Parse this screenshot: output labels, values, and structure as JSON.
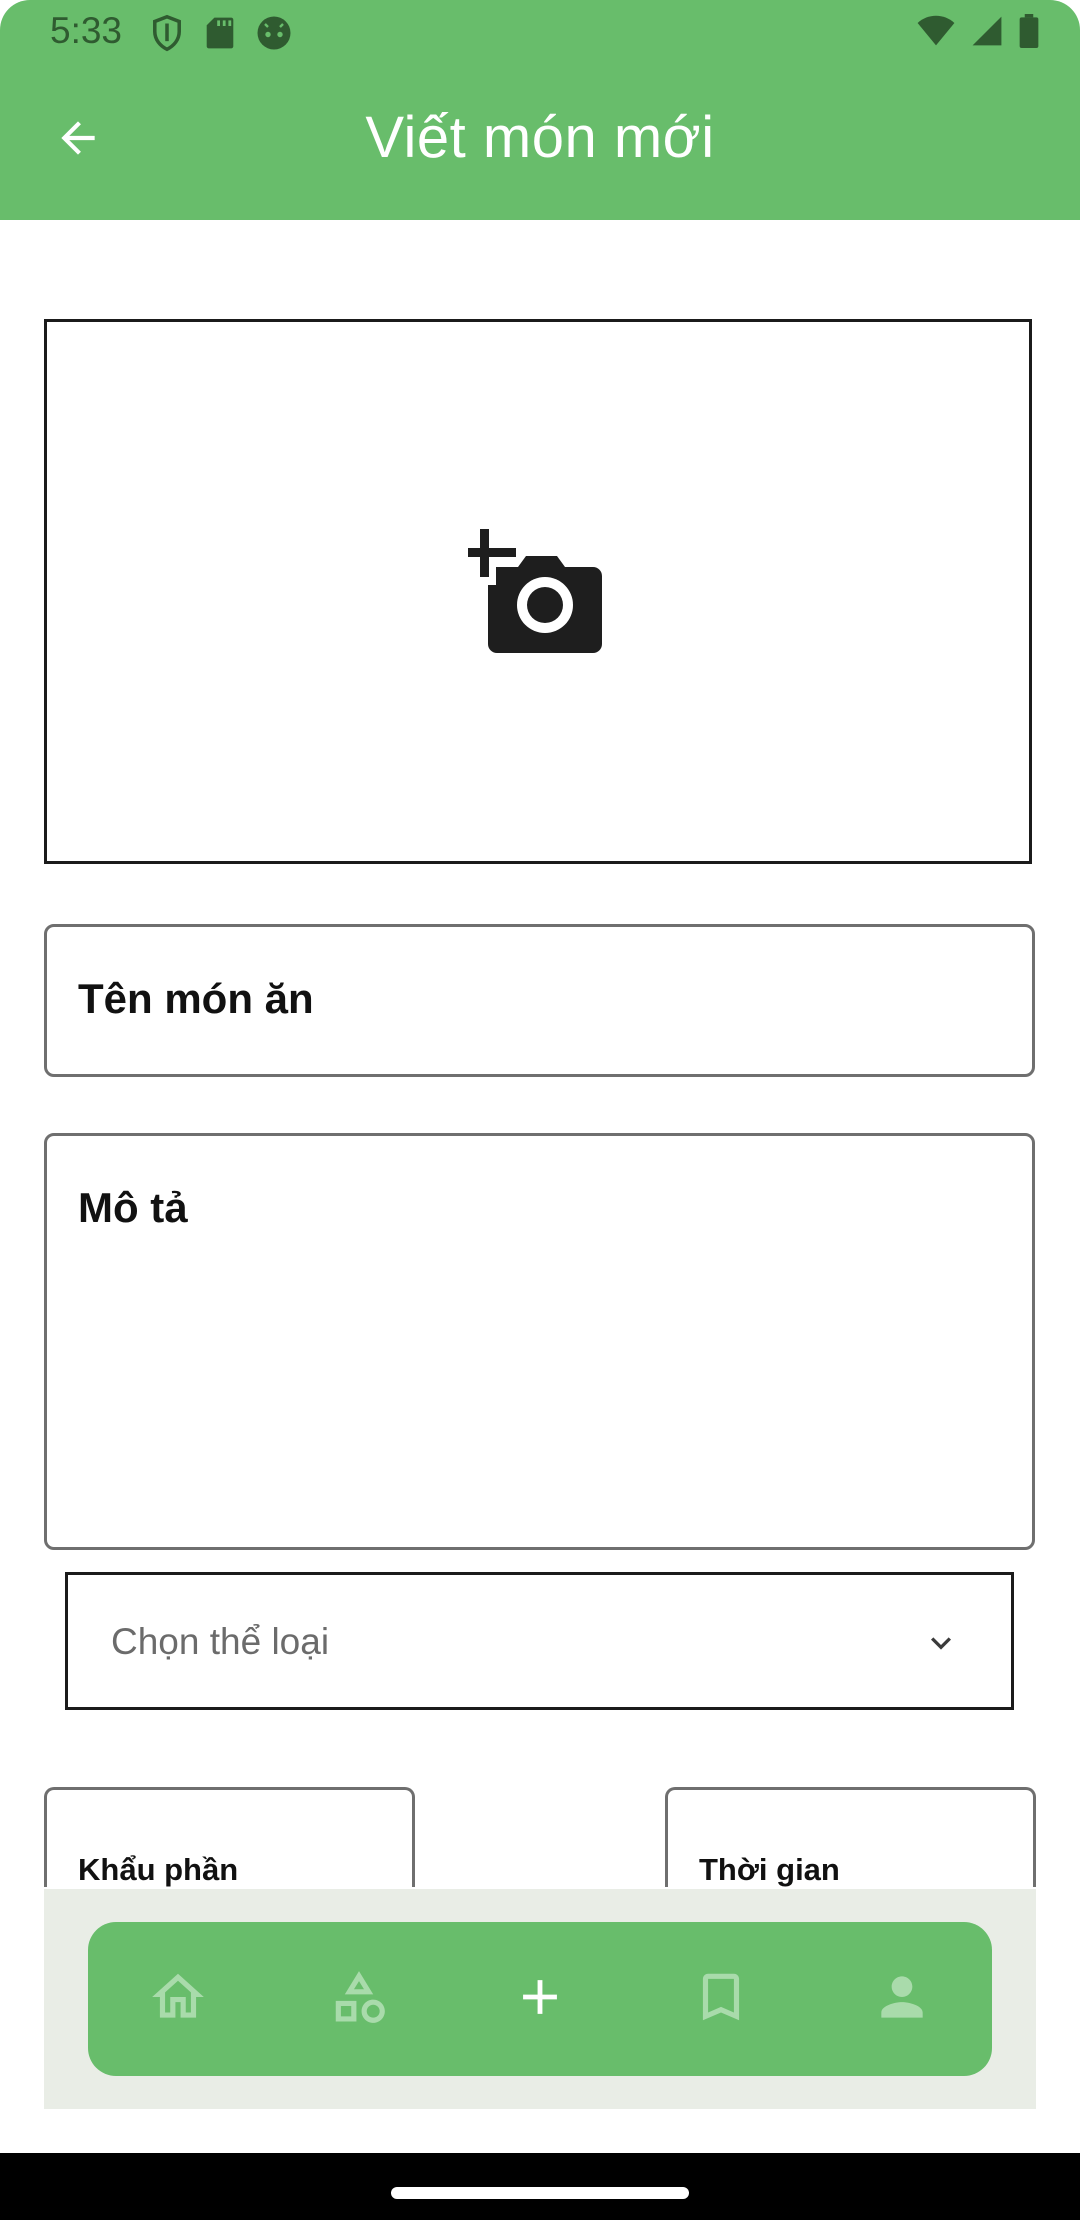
{
  "status_bar": {
    "time": "5:33"
  },
  "app_bar": {
    "title": "Viết món mới"
  },
  "form": {
    "name_label": "Tên món ăn",
    "description_label": "Mô tả",
    "category_placeholder": "Chọn thể loại",
    "servings_label": "Khẩu phần",
    "time_label": "Thời gian"
  },
  "bottom_nav": {
    "items": [
      {
        "icon": "home-icon"
      },
      {
        "icon": "categories-icon"
      },
      {
        "icon": "add-icon"
      },
      {
        "icon": "bookmark-icon"
      },
      {
        "icon": "profile-icon"
      }
    ]
  },
  "colors": {
    "primary": "#68bd6b",
    "nav_inactive_icon": "#a9dbab",
    "nav_active_icon": "#ffffff",
    "nav_background": "#e9ede6"
  }
}
